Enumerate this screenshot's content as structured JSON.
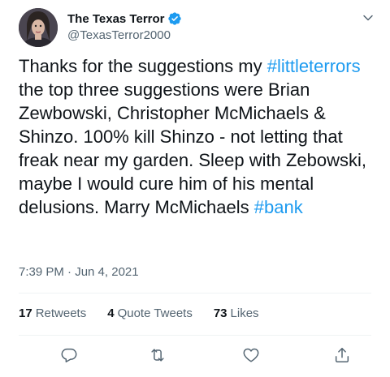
{
  "author": {
    "display_name": "The Texas Terror",
    "handle": "@TexasTerror2000"
  },
  "tweet": {
    "text_1": "Thanks for the suggestions my ",
    "hashtag_1": "#littleterrors",
    "text_2": " the top three suggestions were Brian Zewbowski, Christopher McMichaels & Shinzo. 100% kill Shinzo - not letting that freak near my garden. Sleep with Zebowski, maybe I would cure him of his mental delusions. Marry McMichaels ",
    "hashtag_2": "#bank"
  },
  "timestamp": "7:39 PM · Jun 4, 2021",
  "stats": {
    "retweets_count": "17",
    "retweets_label": "Retweets",
    "quotes_count": "4",
    "quotes_label": "Quote Tweets",
    "likes_count": "73",
    "likes_label": "Likes"
  },
  "colors": {
    "link": "#1d9bf0",
    "text": "#0f1419",
    "muted": "#536471"
  },
  "icons": [
    "verified-badge-icon",
    "chevron-down-icon",
    "reply-icon",
    "retweet-icon",
    "like-icon",
    "share-icon"
  ]
}
